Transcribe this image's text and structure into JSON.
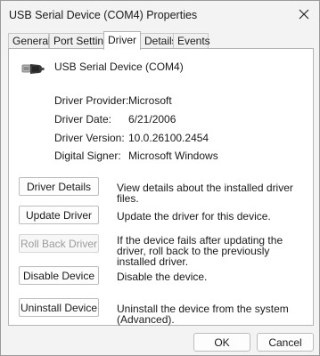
{
  "window": {
    "title": "USB Serial Device (COM4) Properties",
    "close_icon": "close-icon"
  },
  "tabs": [
    {
      "label": "General",
      "active": false
    },
    {
      "label": "Port Settings",
      "active": false
    },
    {
      "label": "Driver",
      "active": true
    },
    {
      "label": "Details",
      "active": false
    },
    {
      "label": "Events",
      "active": false
    }
  ],
  "device": {
    "name": "USB Serial Device (COM4)",
    "icon": "usb-connector-icon"
  },
  "properties": [
    {
      "label": "Driver Provider:",
      "value": "Microsoft"
    },
    {
      "label": "Driver Date:",
      "value": "6/21/2006"
    },
    {
      "label": "Driver Version:",
      "value": "10.0.26100.2454"
    },
    {
      "label": "Digital Signer:",
      "value": "Microsoft Windows"
    }
  ],
  "actions": [
    {
      "button": "Driver Details",
      "description": "View details about the installed driver files.",
      "enabled": true
    },
    {
      "button": "Update Driver",
      "description": "Update the driver for this device.",
      "enabled": true
    },
    {
      "button": "Roll Back Driver",
      "description": "If the device fails after updating the driver, roll back to the previously installed driver.",
      "enabled": false
    },
    {
      "button": "Disable Device",
      "description": "Disable the device.",
      "enabled": true
    },
    {
      "button": "Uninstall Device",
      "description": "Uninstall the device from the system (Advanced).",
      "enabled": true
    }
  ],
  "footer": {
    "ok_label": "OK",
    "cancel_label": "Cancel"
  },
  "colors": {
    "window_bg": "#f3f3f3",
    "panel_bg": "#ffffff",
    "border": "#b4b4b4",
    "disabled_text": "#9c9c9c"
  }
}
